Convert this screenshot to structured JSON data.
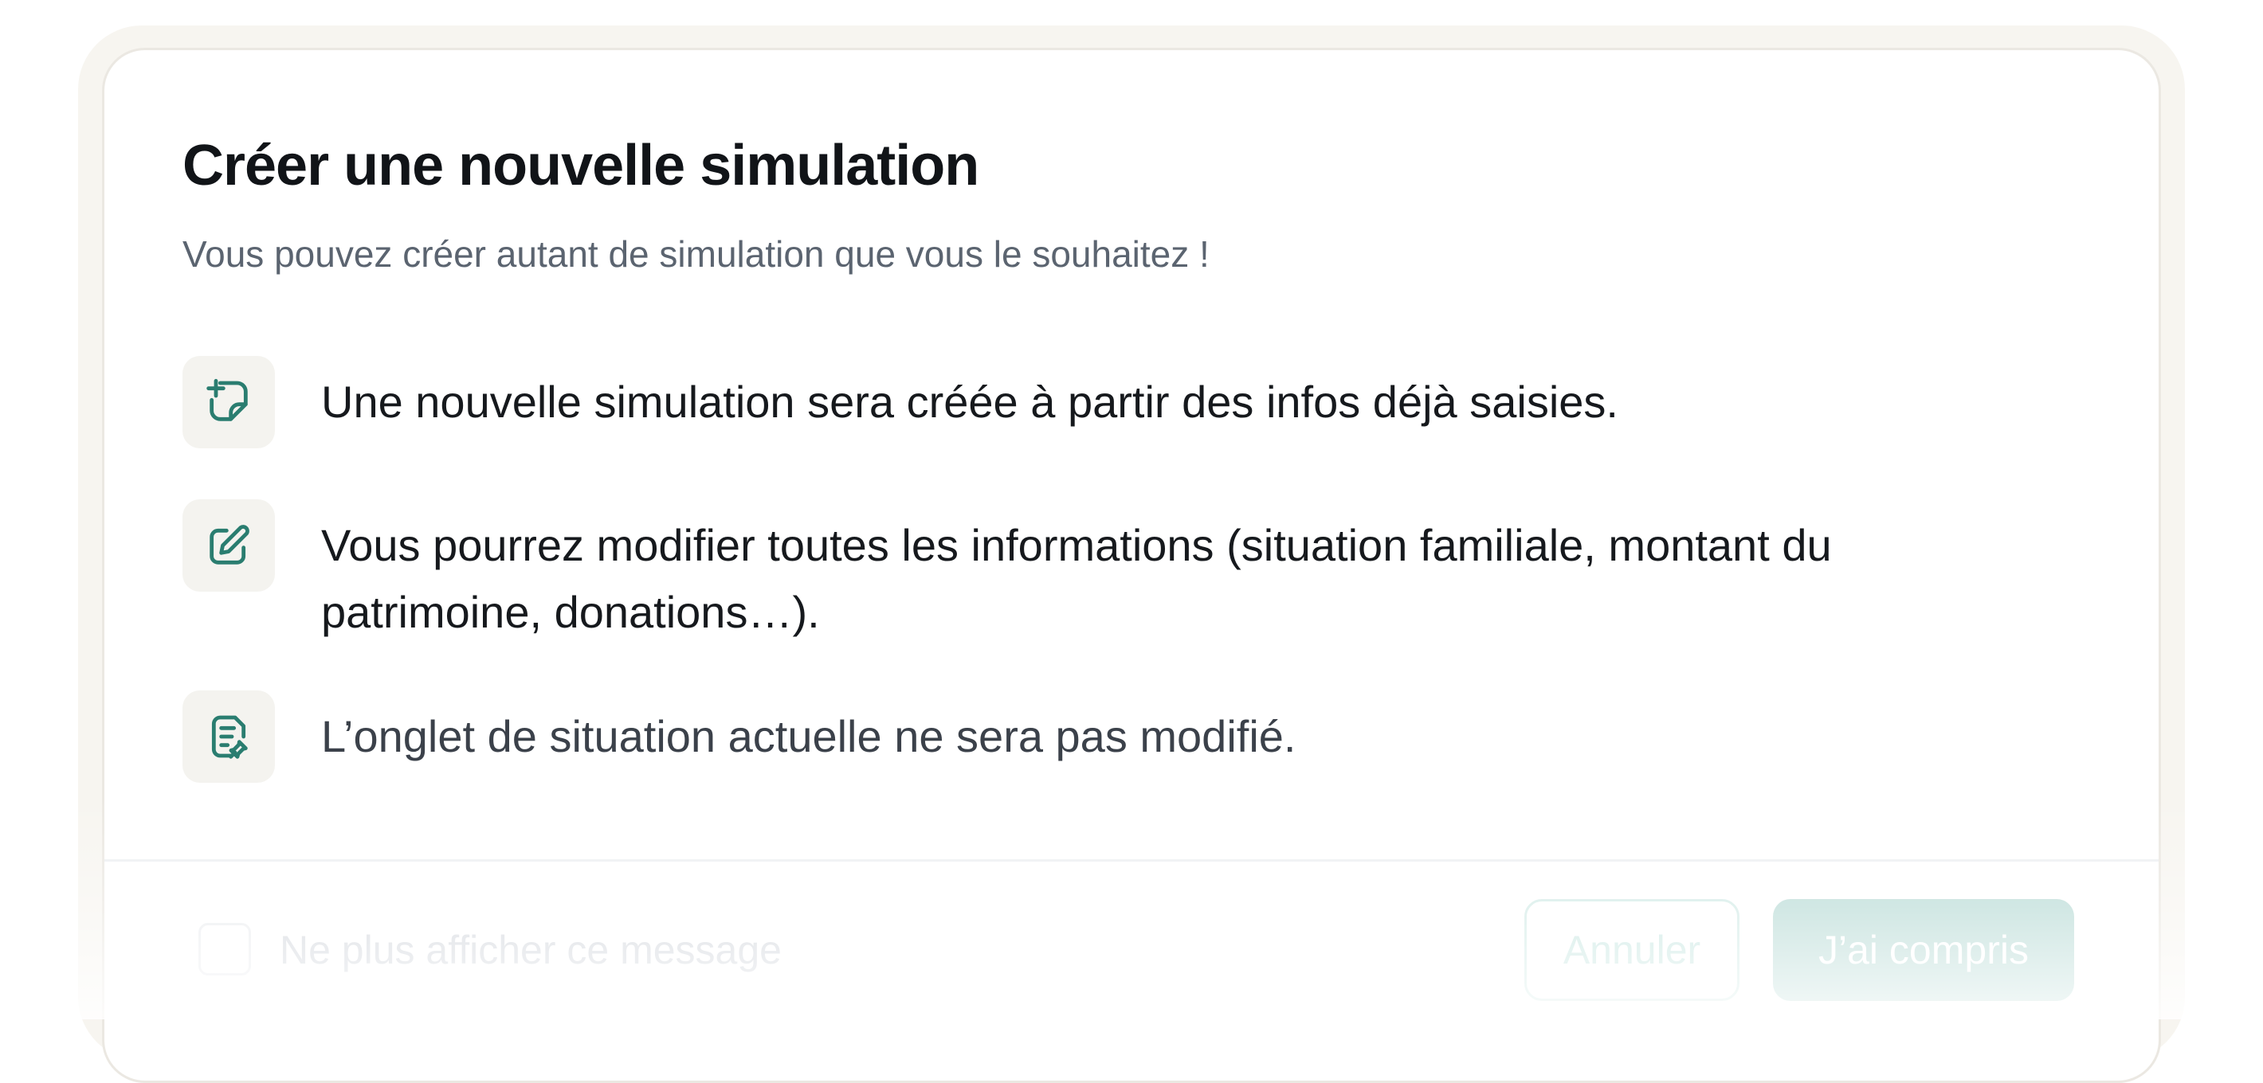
{
  "modal": {
    "title": "Créer une nouvelle simulation",
    "subtitle": "Vous pouvez créer autant de simulation que vous le souhaitez !",
    "items": [
      {
        "icon": "sticky-note-plus-icon",
        "lines": [
          "Une nouvelle simulation sera créée à partir des infos déjà saisies."
        ]
      },
      {
        "icon": "edit-pencil-icon",
        "lines": [
          "Vous pourrez modifier toutes les informations (situation familiale, montant du",
          "patrimoine, donations…)."
        ]
      },
      {
        "icon": "document-pin-icon",
        "lines": [
          "L’onglet de situation actuelle ne sera pas modifié."
        ]
      }
    ],
    "footer": {
      "checkbox_label": "Ne plus afficher ce message",
      "checkbox_checked": false,
      "cancel_label": "Annuler",
      "confirm_label": "J’ai compris"
    }
  },
  "colors": {
    "accent": "#2a7d70",
    "icon_bg": "#f4f3ef",
    "title": "#111418",
    "subtitle": "#5b6470",
    "confirm_bg": "#b9dbd6"
  }
}
